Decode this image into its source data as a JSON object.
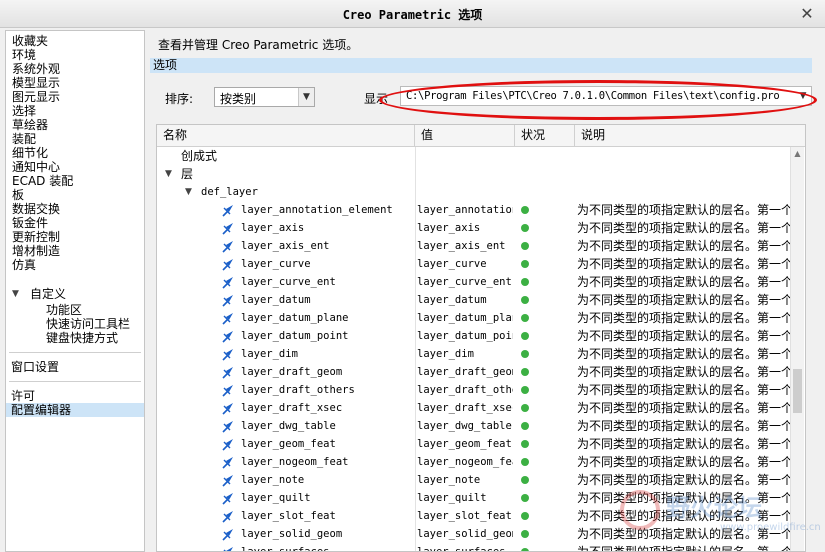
{
  "window": {
    "title": "Creo Parametric 选项"
  },
  "sidebar": {
    "items": [
      "收藏夹",
      "环境",
      "系统外观",
      "模型显示",
      "图元显示",
      "选择",
      "草绘器",
      "装配",
      "细节化",
      "通知中心",
      "ECAD 装配",
      "板",
      "数据交换",
      "钣金件",
      "更新控制",
      "增材制造",
      "仿真"
    ],
    "custom_header": "自定义",
    "custom_items": [
      "功能区",
      "快速访问工具栏",
      "键盘快捷方式"
    ],
    "window_settings": "窗口设置",
    "license": "许可",
    "config_editor": "配置编辑器"
  },
  "main": {
    "description": "查看并管理 Creo Parametric 选项。",
    "section_title": "选项",
    "sort_label": "排序:",
    "sort_value": "按类别",
    "show_label": "显示",
    "show_value": "C:\\Program Files\\PTC\\Creo 7.0.1.0\\Common Files\\text\\config.pro"
  },
  "grid": {
    "headers": {
      "name": "名称",
      "value": "值",
      "status": "状况",
      "note": "说明"
    },
    "tree": {
      "group1": "创成式",
      "group2": "层",
      "group3": "def_layer"
    },
    "rows": [
      {
        "name": "layer_annotation_element",
        "value": "layer_annotation",
        "note": "为不同类型的项指定默认的层名。第一个"
      },
      {
        "name": "layer_axis",
        "value": "layer_axis",
        "note": "为不同类型的项指定默认的层名。第一个"
      },
      {
        "name": "layer_axis_ent",
        "value": "layer_axis_ent",
        "note": "为不同类型的项指定默认的层名。第一个"
      },
      {
        "name": "layer_curve",
        "value": "layer_curve",
        "note": "为不同类型的项指定默认的层名。第一个"
      },
      {
        "name": "layer_curve_ent",
        "value": "layer_curve_ent",
        "note": "为不同类型的项指定默认的层名。第一个"
      },
      {
        "name": "layer_datum",
        "value": "layer_datum",
        "note": "为不同类型的项指定默认的层名。第一个"
      },
      {
        "name": "layer_datum_plane",
        "value": "layer_datum_plan",
        "note": "为不同类型的项指定默认的层名。第一个"
      },
      {
        "name": "layer_datum_point",
        "value": "layer_datum_poin",
        "note": "为不同类型的项指定默认的层名。第一个"
      },
      {
        "name": "layer_dim",
        "value": "layer_dim",
        "note": "为不同类型的项指定默认的层名。第一个"
      },
      {
        "name": "layer_draft_geom",
        "value": "layer_draft_geom",
        "note": "为不同类型的项指定默认的层名。第一个"
      },
      {
        "name": "layer_draft_others",
        "value": "layer_draft_other",
        "note": "为不同类型的项指定默认的层名。第一个"
      },
      {
        "name": "layer_draft_xsec",
        "value": "layer_draft_xsec",
        "note": "为不同类型的项指定默认的层名。第一个"
      },
      {
        "name": "layer_dwg_table",
        "value": "layer_dwg_table",
        "note": "为不同类型的项指定默认的层名。第一个"
      },
      {
        "name": "layer_geom_feat",
        "value": "layer_geom_feat",
        "note": "为不同类型的项指定默认的层名。第一个"
      },
      {
        "name": "layer_nogeom_feat",
        "value": "layer_nogeom_fea",
        "note": "为不同类型的项指定默认的层名。第一个"
      },
      {
        "name": "layer_note",
        "value": "layer_note",
        "note": "为不同类型的项指定默认的层名。第一个"
      },
      {
        "name": "layer_quilt",
        "value": "layer_quilt",
        "note": "为不同类型的项指定默认的层名。第一个"
      },
      {
        "name": "layer_slot_feat",
        "value": "layer_slot_feat",
        "note": "为不同类型的项指定默认的层名。第一个"
      },
      {
        "name": "layer_solid_geom",
        "value": "layer_solid_geom",
        "note": "为不同类型的项指定默认的层名。第一个"
      },
      {
        "name": "layer_surfaces",
        "value": "layer_surfaces",
        "note": "为不同类型的项指定默认的层名。第一个"
      }
    ]
  },
  "watermark": {
    "text": "野火论坛",
    "url": "www.proewildfire.cn"
  },
  "colors": {
    "selection": "#cde4f7",
    "status_ok": "#3cb043",
    "highlight_ellipse": "#e01010"
  },
  "icons": {
    "row_icon": "pin-icon",
    "close": "close-icon"
  }
}
